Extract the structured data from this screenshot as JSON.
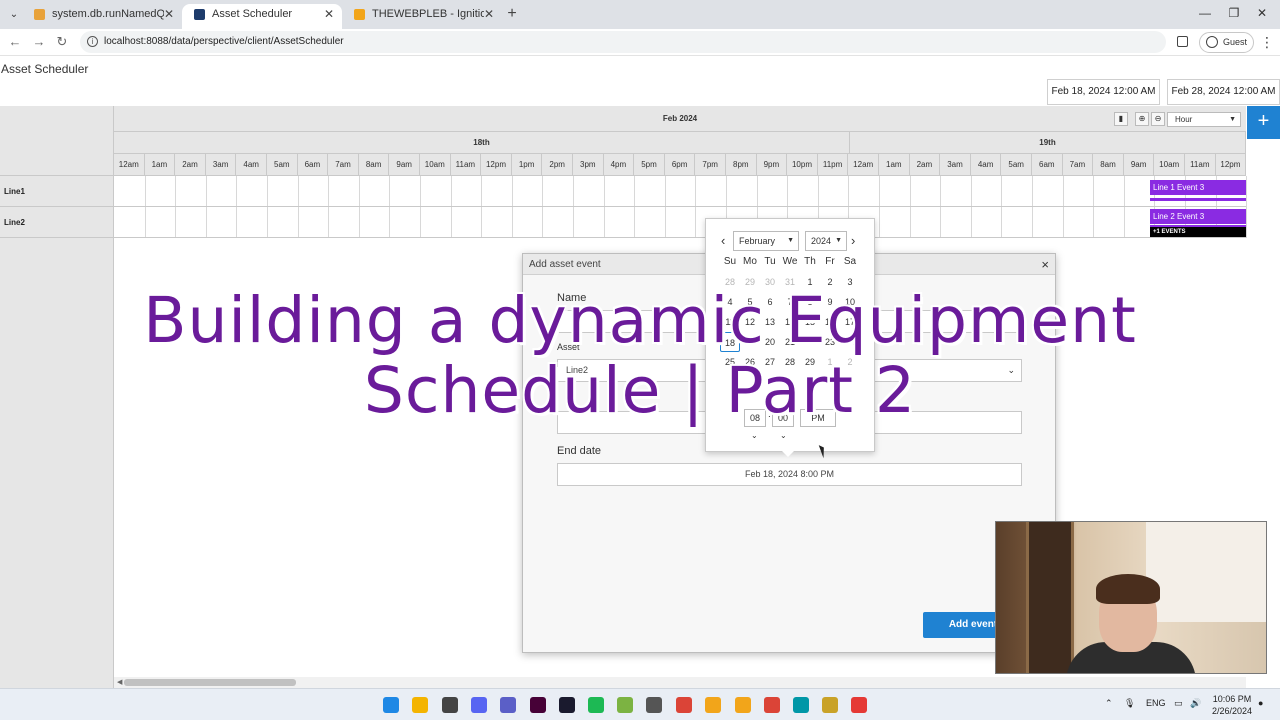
{
  "browser": {
    "tabs": [
      {
        "title": "system.db.runNamedQuery | Ig",
        "favicon_color": "#e8a23a",
        "active": false
      },
      {
        "title": "Asset Scheduler",
        "favicon_color": "#1d3b6b",
        "active": true
      },
      {
        "title": "THEWEBPLEB - Ignition Gatewa",
        "favicon_color": "#f2a51a",
        "active": false
      }
    ],
    "new_tab": "+",
    "url": "localhost:8088/data/perspective/client/AssetScheduler",
    "profile_label": "Guest",
    "window_controls": {
      "minimize": "—",
      "maximize": "❐",
      "close": "✕"
    }
  },
  "app": {
    "title": "Asset Scheduler",
    "start_date": "Feb 18, 2024 12:00 AM",
    "end_date": "Feb 28, 2024 12:00 AM",
    "add_button": "+"
  },
  "scheduler": {
    "month_label": "Feb 2024",
    "days": [
      "18th",
      "19th"
    ],
    "hours": [
      "12am",
      "1am",
      "2am",
      "3am",
      "4am",
      "5am",
      "6am",
      "7am",
      "8am",
      "9am",
      "10am",
      "11am",
      "12pm",
      "1pm",
      "2pm",
      "3pm",
      "4pm",
      "5pm",
      "6pm",
      "7pm",
      "8pm",
      "9pm",
      "10pm",
      "11pm",
      "12am",
      "1am",
      "2am",
      "3am",
      "4am",
      "5am",
      "6am",
      "7am",
      "8am",
      "9am",
      "10am",
      "11am",
      "12pm"
    ],
    "resources": [
      "Line1",
      "Line2"
    ],
    "view_select": "Hour",
    "tool_icons": [
      "trash-icon",
      "zoom-in-icon",
      "zoom-out-icon"
    ],
    "events": [
      {
        "label": "Line 1 Event 3",
        "resource": "Line1"
      },
      {
        "label": "Line 2 Event 3",
        "resource": "Line2"
      }
    ],
    "more_label": "+1 EVENTS",
    "colors": {
      "event": "#8a2be2",
      "accent": "#1f82d2"
    }
  },
  "modal": {
    "title": "Add asset event",
    "close": "×",
    "name_label": "Name",
    "asset_label": "Asset",
    "asset_value": "Line2",
    "end_date_label": "End date",
    "end_date_value": "Feb 18, 2024 8:00 PM",
    "submit_label": "Add event"
  },
  "datepicker": {
    "month": "February",
    "year": "2024",
    "weekdays": [
      "Su",
      "Mo",
      "Tu",
      "We",
      "Th",
      "Fr",
      "Sa"
    ],
    "weeks": [
      [
        {
          "d": "28",
          "m": true
        },
        {
          "d": "29",
          "m": true
        },
        {
          "d": "30",
          "m": true
        },
        {
          "d": "31",
          "m": true
        },
        {
          "d": "1"
        },
        {
          "d": "2"
        },
        {
          "d": "3"
        }
      ],
      [
        {
          "d": "4"
        },
        {
          "d": "5"
        },
        {
          "d": "6"
        },
        {
          "d": "7"
        },
        {
          "d": "8"
        },
        {
          "d": "9"
        },
        {
          "d": "10"
        }
      ],
      [
        {
          "d": "11"
        },
        {
          "d": "12"
        },
        {
          "d": "13"
        },
        {
          "d": "14"
        },
        {
          "d": "15"
        },
        {
          "d": "16"
        },
        {
          "d": "17"
        }
      ],
      [
        {
          "d": "18",
          "s": true
        },
        {
          "d": "19"
        },
        {
          "d": "20"
        },
        {
          "d": "21"
        },
        {
          "d": "22"
        },
        {
          "d": "23"
        },
        {
          "d": "24"
        }
      ],
      [
        {
          "d": "25"
        },
        {
          "d": "26"
        },
        {
          "d": "27"
        },
        {
          "d": "28"
        },
        {
          "d": "29"
        },
        {
          "d": "1",
          "m": true
        },
        {
          "d": "2",
          "m": true
        }
      ]
    ],
    "hour": "08",
    "minute": "00",
    "meridiem": "PM"
  },
  "overlay": {
    "line1": "Building a dynamic Equipment",
    "line2": "Schedule | Part 2"
  },
  "taskbar": {
    "apps": [
      {
        "name": "windows-start-icon",
        "color": "#1e88e5"
      },
      {
        "name": "file-explorer-icon",
        "color": "#f4b400"
      },
      {
        "name": "github-desktop-icon",
        "color": "#444444"
      },
      {
        "name": "discord-icon",
        "color": "#5865f2"
      },
      {
        "name": "teams-icon",
        "color": "#5b5fc7"
      },
      {
        "name": "adobe-xd-icon",
        "color": "#470137"
      },
      {
        "name": "intellij-icon",
        "color": "#1a1a2e"
      },
      {
        "name": "spotify-icon",
        "color": "#1db954"
      },
      {
        "name": "notepad-plus-icon",
        "color": "#7cb342"
      },
      {
        "name": "git-extensions-icon",
        "color": "#555555"
      },
      {
        "name": "chrome-icon",
        "color": "#db4437"
      },
      {
        "name": "ignition-designer-icon",
        "color": "#f2a51a"
      },
      {
        "name": "ignition-launcher-icon",
        "color": "#f2a51a"
      },
      {
        "name": "chrome-active-icon",
        "color": "#db4437"
      },
      {
        "name": "vpn-icon",
        "color": "#0097a7"
      },
      {
        "name": "file-manager-icon",
        "color": "#c9a227"
      },
      {
        "name": "snipping-tool-icon",
        "color": "#e53935"
      }
    ],
    "language": "ENG",
    "time": "10:06 PM",
    "date": "2/26/2024"
  }
}
